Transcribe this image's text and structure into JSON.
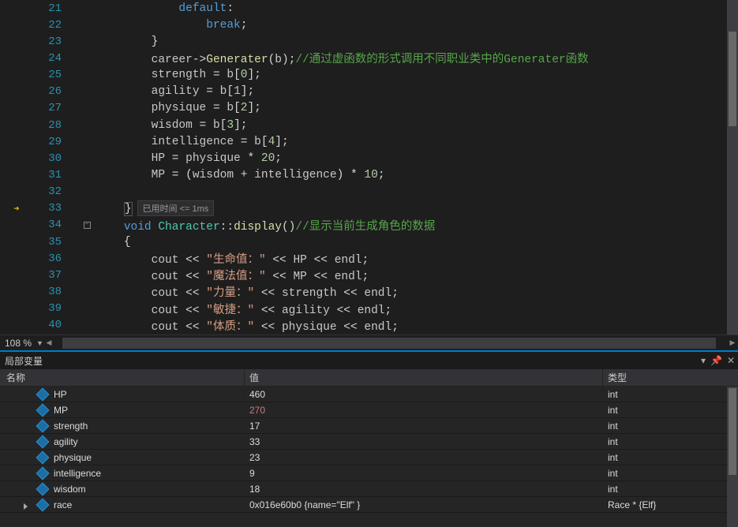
{
  "zoom": "108 %",
  "perf_hint": "已用时间 <= 1ms",
  "locals_title": "局部变量",
  "headers": {
    "name": "名称",
    "value": "值",
    "type": "类型"
  },
  "lines": [
    {
      "n": 21,
      "bar": true,
      "html": "            <span class='kw'>default</span><span class='op'>:</span>"
    },
    {
      "n": 22,
      "bar": true,
      "html": "                <span class='kw'>break</span><span class='op'>;</span>"
    },
    {
      "n": 23,
      "bar": true,
      "html": "        <span class='op'>}</span>"
    },
    {
      "n": 24,
      "bar": true,
      "html": "        <span class='ident'>career</span><span class='op'>-&gt;</span><span class='fn'>Generater</span><span class='op'>(</span><span class='ident'>b</span><span class='op'>)</span><span class='op'>;</span><span class='cmt'>//通过虚函数的形式调用不同职业类中的Generater函数</span>"
    },
    {
      "n": 25,
      "bar": false,
      "html": "        <span class='ident'>strength</span> <span class='op'>=</span> <span class='ident'>b</span><span class='op'>[</span><span class='num'>0</span><span class='op'>];</span>"
    },
    {
      "n": 26,
      "bar": false,
      "html": "        <span class='ident'>agility</span> <span class='op'>=</span> <span class='ident'>b</span><span class='op'>[</span><span class='num'>1</span><span class='op'>];</span>"
    },
    {
      "n": 27,
      "bar": false,
      "html": "        <span class='ident'>physique</span> <span class='op'>=</span> <span class='ident'>b</span><span class='op'>[</span><span class='num'>2</span><span class='op'>];</span>"
    },
    {
      "n": 28,
      "bar": false,
      "html": "        <span class='ident'>wisdom</span> <span class='op'>=</span> <span class='ident'>b</span><span class='op'>[</span><span class='num'>3</span><span class='op'>];</span>"
    },
    {
      "n": 29,
      "bar": false,
      "html": "        <span class='ident'>intelligence</span> <span class='op'>=</span> <span class='ident'>b</span><span class='op'>[</span><span class='num'>4</span><span class='op'>];</span>"
    },
    {
      "n": 30,
      "bar": false,
      "html": "        <span class='ident'>HP</span> <span class='op'>=</span> <span class='ident'>physique</span> <span class='op'>*</span> <span class='num'>20</span><span class='op'>;</span>"
    },
    {
      "n": 31,
      "bar": false,
      "html": "        <span class='ident'>MP</span> <span class='op'>=</span> <span class='op'>(</span><span class='ident'>wisdom</span> <span class='op'>+</span> <span class='ident'>intelligence</span><span class='op'>)</span> <span class='op'>*</span> <span class='num'>10</span><span class='op'>;</span>"
    },
    {
      "n": 32,
      "bar": false,
      "html": ""
    },
    {
      "n": 33,
      "bar": false,
      "bp": true,
      "html": "    <span class='op brace-hl'>}</span>",
      "perf": true
    },
    {
      "n": 34,
      "bar": true,
      "fold": "-",
      "html": "    <span class='kw'>void</span> <span class='type'>Character</span><span class='op'>::</span><span class='fn'>display</span><span class='op'>()</span><span class='cmt'>//显示当前生成角色的数据</span>"
    },
    {
      "n": 35,
      "bar": false,
      "html": "    <span class='op'>{</span>"
    },
    {
      "n": 36,
      "bar": false,
      "html": "        <span class='ident'>cout</span> <span class='op'>&lt;&lt;</span> <span class='str'>\"生命值：\"</span> <span class='op'>&lt;&lt;</span> <span class='ident'>HP</span> <span class='op'>&lt;&lt;</span> <span class='ident'>endl</span><span class='op'>;</span>"
    },
    {
      "n": 37,
      "bar": false,
      "html": "        <span class='ident'>cout</span> <span class='op'>&lt;&lt;</span> <span class='str'>\"魔法值：\"</span> <span class='op'>&lt;&lt;</span> <span class='ident'>MP</span> <span class='op'>&lt;&lt;</span> <span class='ident'>endl</span><span class='op'>;</span>"
    },
    {
      "n": 38,
      "bar": false,
      "html": "        <span class='ident'>cout</span> <span class='op'>&lt;&lt;</span> <span class='str'>\"力量：\"</span> <span class='op'>&lt;&lt;</span> <span class='ident'>strength</span> <span class='op'>&lt;&lt;</span> <span class='ident'>endl</span><span class='op'>;</span>"
    },
    {
      "n": 39,
      "bar": false,
      "html": "        <span class='ident'>cout</span> <span class='op'>&lt;&lt;</span> <span class='str'>\"敏捷：\"</span> <span class='op'>&lt;&lt;</span> <span class='ident'>agility</span> <span class='op'>&lt;&lt;</span> <span class='ident'>endl</span><span class='op'>;</span>"
    },
    {
      "n": 40,
      "bar": false,
      "html": "        <span class='ident'>cout</span> <span class='op'>&lt;&lt;</span> <span class='str'>\"体质：\"</span> <span class='op'>&lt;&lt;</span> <span class='ident'>physique</span> <span class='op'>&lt;&lt;</span> <span class='ident'>endl</span><span class='op'>;</span>"
    }
  ],
  "locals": [
    {
      "name": "HP",
      "value": "460",
      "type": "int",
      "changed": false
    },
    {
      "name": "MP",
      "value": "270",
      "type": "int",
      "changed": true
    },
    {
      "name": "strength",
      "value": "17",
      "type": "int",
      "changed": false
    },
    {
      "name": "agility",
      "value": "33",
      "type": "int",
      "changed": false
    },
    {
      "name": "physique",
      "value": "23",
      "type": "int",
      "changed": false
    },
    {
      "name": "intelligence",
      "value": "9",
      "type": "int",
      "changed": false
    },
    {
      "name": "wisdom",
      "value": "18",
      "type": "int",
      "changed": false
    },
    {
      "name": "race",
      "value": "0x016e60b0 {name=\"Elf\" }",
      "type": "Race * {Elf}",
      "changed": false,
      "expand": true
    }
  ]
}
